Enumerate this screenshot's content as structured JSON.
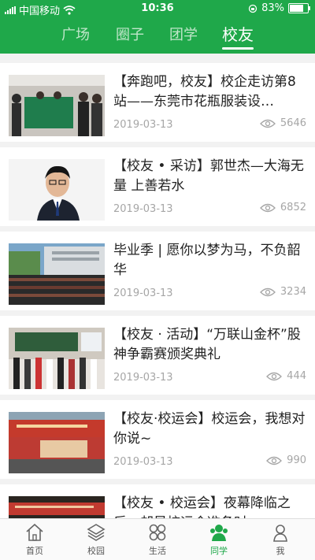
{
  "status_bar": {
    "carrier": "中国移动",
    "time": "10:36",
    "battery": "83%",
    "battery_level": 0.83
  },
  "top_tabs": [
    {
      "label": "广场",
      "active": false
    },
    {
      "label": "圈子",
      "active": false
    },
    {
      "label": "团学",
      "active": false
    },
    {
      "label": "校友",
      "active": true
    }
  ],
  "articles": [
    {
      "title": "【奔跑吧，校友】校企走访第8站——东莞市花瓶服装设…",
      "date": "2019-03-13",
      "views": "5646"
    },
    {
      "title": "【校友 • 采访】郭世杰—大海无量 上善若水",
      "date": "2019-03-13",
      "views": "6852"
    },
    {
      "title": "毕业季 | 愿你以梦为马，不负韶华",
      "date": "2019-03-13",
      "views": "3234"
    },
    {
      "title": "【校友 · 活动】“万联山金杯”股神争霸赛颁奖典礼",
      "date": "2019-03-13",
      "views": "444"
    },
    {
      "title": "【校友·校运会】校运会，我想对你说~",
      "date": "2019-03-13",
      "views": "990"
    },
    {
      "title": "【校友 • 校运会】夜幕降临之后，却是校运会准备时",
      "date": "",
      "views": ""
    }
  ],
  "bottom_tabs": [
    {
      "label": "首页",
      "icon": "home-icon",
      "active": false
    },
    {
      "label": "校园",
      "icon": "layers-icon",
      "active": false
    },
    {
      "label": "生活",
      "icon": "grid-icon",
      "active": false
    },
    {
      "label": "同学",
      "icon": "people-icon",
      "active": true
    },
    {
      "label": "我",
      "icon": "person-icon",
      "active": false
    }
  ],
  "colors": {
    "brand": "#1fa84a",
    "muted": "#a6a6a6"
  }
}
